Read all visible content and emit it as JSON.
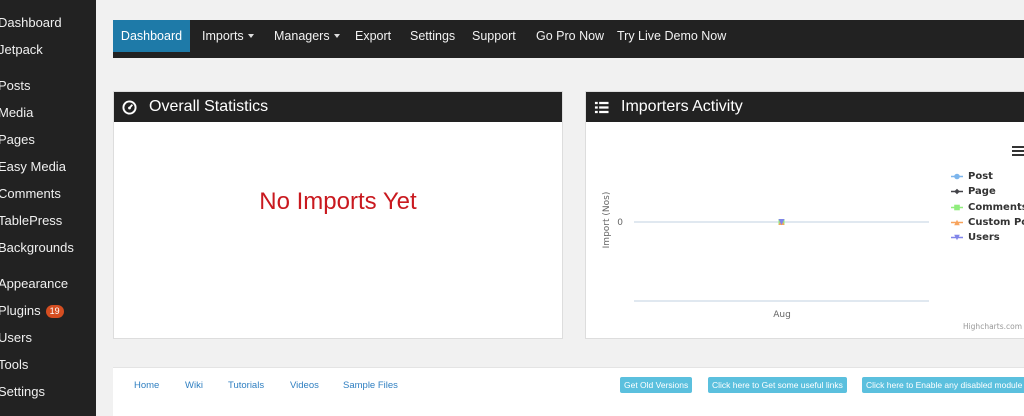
{
  "sidebar": {
    "items": [
      {
        "label": "Dashboard"
      },
      {
        "label": "Jetpack"
      },
      {
        "label": "Posts"
      },
      {
        "label": "Media"
      },
      {
        "label": "Pages"
      },
      {
        "label": "Easy Media"
      },
      {
        "label": "Comments"
      },
      {
        "label": "TablePress"
      },
      {
        "label": "Backgrounds"
      },
      {
        "label": "Appearance"
      },
      {
        "label": "Plugins",
        "badge": "19"
      },
      {
        "label": "Users"
      },
      {
        "label": "Tools"
      },
      {
        "label": "Settings"
      }
    ]
  },
  "nav": {
    "items": [
      {
        "label": "Dashboard",
        "active": true
      },
      {
        "label": "Imports",
        "dropdown": true
      },
      {
        "label": "Managers",
        "dropdown": true
      },
      {
        "label": "Export"
      },
      {
        "label": "Settings"
      },
      {
        "label": "Support"
      },
      {
        "label": "Go Pro Now"
      },
      {
        "label": "Try Live Demo Now"
      }
    ]
  },
  "stats_panel": {
    "title": "Overall Statistics",
    "icon": "dashboard-gauge-icon",
    "empty_message": "No Imports Yet"
  },
  "activity_panel": {
    "title": "Importers Activity",
    "icon": "list-icon",
    "credits": "Highcharts.com"
  },
  "chart_data": {
    "type": "line",
    "categories": [
      "Aug"
    ],
    "ylabel": "Import (Nos)",
    "xlabel": "",
    "yticks": [
      "0"
    ],
    "series": [
      {
        "name": "Post",
        "values": [
          0
        ],
        "color": "#7cb5ec",
        "marker": "circle"
      },
      {
        "name": "Page",
        "values": [
          0
        ],
        "color": "#434348",
        "marker": "diamond"
      },
      {
        "name": "Comments",
        "values": [
          0
        ],
        "color": "#90ed7d",
        "marker": "square"
      },
      {
        "name": "Custom Pos",
        "values": [
          0
        ],
        "color": "#f7a35c",
        "marker": "triangle"
      },
      {
        "name": "Users",
        "values": [
          0
        ],
        "color": "#8085e9",
        "marker": "triangle-down"
      }
    ]
  },
  "footer": {
    "links": [
      "Home",
      "Wiki",
      "Tutorials",
      "Videos",
      "Sample Files"
    ],
    "buttons": [
      "Get Old Versions",
      "Click here to Get some useful links",
      "Click here to Enable any disabled module"
    ]
  },
  "colors": {
    "nav_active": "#1e7aa8",
    "empty_message": "#c9191f",
    "button": "#5bc0de",
    "link": "#2f7fc1"
  }
}
